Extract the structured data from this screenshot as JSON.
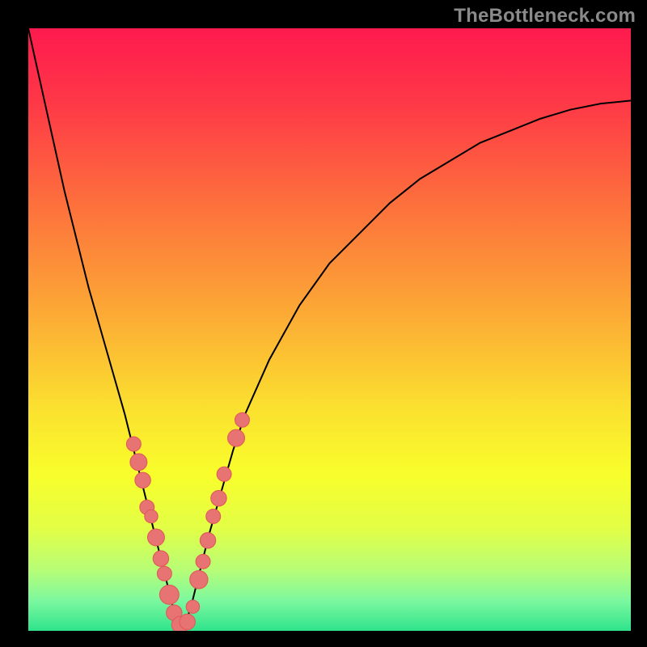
{
  "watermark": "TheBottleneck.com",
  "colors": {
    "frame": "#000000",
    "curve": "#000000",
    "marker_fill": "#E77373",
    "marker_stroke": "#E05A5A",
    "gradient_stops": [
      {
        "pct": 0,
        "hex": "#FE1A4E"
      },
      {
        "pct": 12,
        "hex": "#FE3747"
      },
      {
        "pct": 28,
        "hex": "#FD6C3D"
      },
      {
        "pct": 45,
        "hex": "#FCA236"
      },
      {
        "pct": 63,
        "hex": "#FBE02F"
      },
      {
        "pct": 74,
        "hex": "#F8FE2B"
      },
      {
        "pct": 83,
        "hex": "#E2FE46"
      },
      {
        "pct": 90,
        "hex": "#B6FD77"
      },
      {
        "pct": 95,
        "hex": "#7CF89F"
      },
      {
        "pct": 100,
        "hex": "#2FE38C"
      }
    ]
  },
  "chart_data": {
    "type": "line",
    "title": "",
    "xlabel": "",
    "ylabel": "",
    "xlim": [
      0,
      100
    ],
    "ylim": [
      0,
      100
    ],
    "note": "x is horizontal position 0–100 across plot; y is vertical 0=top 100=bottom (bottleneck % where 100 = no bottleneck). Curve is V-shaped with minimum (best match) near x≈25.",
    "series": [
      {
        "name": "bottleneck-curve",
        "x": [
          0,
          2,
          4,
          6,
          8,
          10,
          12,
          14,
          16,
          18,
          20,
          21,
          22,
          23,
          24,
          25,
          26,
          27,
          28,
          30,
          32,
          34,
          36,
          40,
          45,
          50,
          55,
          60,
          65,
          70,
          75,
          80,
          85,
          90,
          95,
          100
        ],
        "y": [
          0,
          9,
          18,
          27,
          35,
          43,
          50,
          57,
          64,
          72,
          80,
          84,
          88,
          92,
          96,
          99,
          99,
          96,
          92,
          84,
          77,
          70,
          64,
          55,
          46,
          39,
          34,
          29,
          25,
          22,
          19,
          17,
          15,
          13.5,
          12.5,
          12
        ]
      }
    ],
    "markers": {
      "name": "highlighted-points",
      "note": "pink round markers clustered near the curve's valley on both arms",
      "points": [
        {
          "x": 17.5,
          "y": 69,
          "r": 1.2
        },
        {
          "x": 18.3,
          "y": 72,
          "r": 1.4
        },
        {
          "x": 19.0,
          "y": 75,
          "r": 1.3
        },
        {
          "x": 19.7,
          "y": 79.5,
          "r": 1.2
        },
        {
          "x": 20.4,
          "y": 81,
          "r": 1.1
        },
        {
          "x": 21.2,
          "y": 84.5,
          "r": 1.4
        },
        {
          "x": 22.0,
          "y": 88,
          "r": 1.3
        },
        {
          "x": 22.6,
          "y": 90.5,
          "r": 1.2
        },
        {
          "x": 23.4,
          "y": 94,
          "r": 1.6
        },
        {
          "x": 24.2,
          "y": 97,
          "r": 1.3
        },
        {
          "x": 25.2,
          "y": 99,
          "r": 1.4
        },
        {
          "x": 26.4,
          "y": 98.5,
          "r": 1.3
        },
        {
          "x": 27.3,
          "y": 96,
          "r": 1.1
        },
        {
          "x": 28.3,
          "y": 91.5,
          "r": 1.5
        },
        {
          "x": 29.0,
          "y": 88.5,
          "r": 1.2
        },
        {
          "x": 29.8,
          "y": 85,
          "r": 1.3
        },
        {
          "x": 30.7,
          "y": 81,
          "r": 1.2
        },
        {
          "x": 31.6,
          "y": 78,
          "r": 1.3
        },
        {
          "x": 32.5,
          "y": 74,
          "r": 1.2
        },
        {
          "x": 34.5,
          "y": 68,
          "r": 1.4
        },
        {
          "x": 35.5,
          "y": 65,
          "r": 1.2
        }
      ]
    }
  }
}
